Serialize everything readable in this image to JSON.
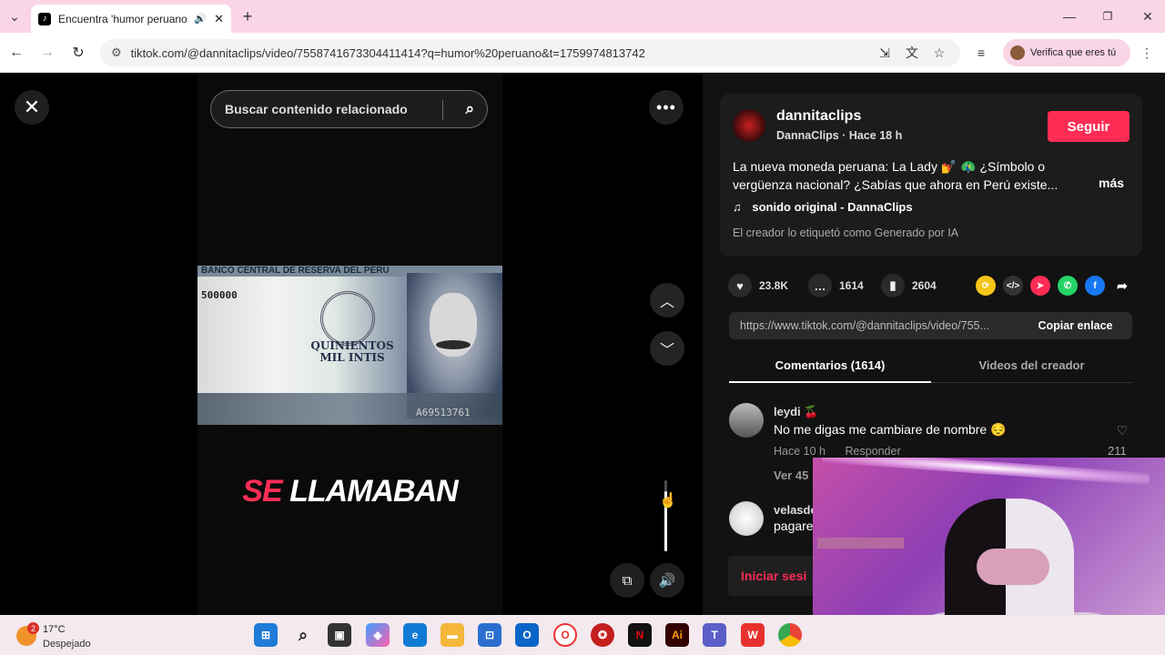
{
  "browser": {
    "tab_title": "Encuentra 'humor peruano'",
    "url": "tiktok.com/@dannitaclips/video/7558741673304411414?q=humor%20peruano&t=1759974813742",
    "verify_label": "Verifica que eres tú"
  },
  "video": {
    "search_placeholder": "Buscar contenido relacionado",
    "caption_red": "SE",
    "caption_white": "LLAMABAN",
    "bill_band_text": "BANCO CENTRAL DE RESERVA DEL PERU",
    "bill_serial_a": "500000",
    "bill_amount_line1": "QUINIENTOS",
    "bill_amount_line2": "MIL INTIS",
    "bill_serial_b": "A69513761",
    "volume_level": 0.85
  },
  "post": {
    "username": "dannitaclips",
    "display_line": "DannaClips · Hace 18 h",
    "follow_label": "Seguir",
    "description": "La nueva moneda peruana: La Lady 💅 🦚 ¿Símbolo o vergüenza nacional? ¿Sabías que ahora en Perú existe...",
    "more_label": "más",
    "music": "sonido original - DannaClips",
    "ai_label": "El creador lo etiquetó como Generado por IA",
    "likes": "23.8K",
    "comments": "1614",
    "saves": "2604",
    "share_link": "https://www.tiktok.com/@dannitaclips/video/755...",
    "copy_label": "Copiar enlace"
  },
  "tabs": {
    "comments": "Comentarios (1614)",
    "videos": "Videos del creador"
  },
  "comments": [
    {
      "name": "leydi 🍒",
      "text": "No me digas me cambiare de nombre 😔",
      "time": "Hace 10 h",
      "reply": "Responder",
      "likes": "211",
      "view_more": "Ver 45"
    },
    {
      "name": "velasde",
      "text": "pagare"
    }
  ],
  "login_label": "Iniciar sesi",
  "taskbar": {
    "weather_temp": "17°C",
    "weather_cond": "Despejado",
    "weather_badge": "2"
  },
  "colors": {
    "accent": "#fe2c55",
    "tab_strip": "#f9d5e5"
  }
}
